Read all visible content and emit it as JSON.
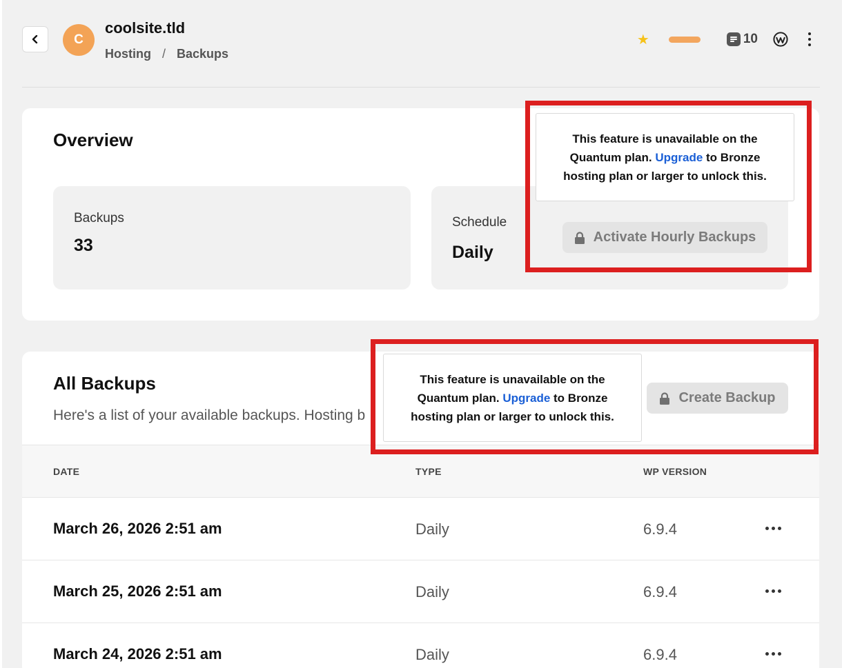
{
  "header": {
    "avatar_letter": "C",
    "site_name": "coolsite.tld",
    "breadcrumb": [
      "Hosting",
      "/",
      "Backups"
    ],
    "count": "10",
    "icons": [
      "back-chevron-icon",
      "star-icon",
      "document-icon",
      "wordpress-icon",
      "kebab-menu-icon"
    ]
  },
  "overview": {
    "title": "Overview",
    "backups_label": "Backups",
    "backups_value": "33",
    "schedule_label": "Schedule",
    "schedule_value": "Daily",
    "tooltip": {
      "before": "This feature is unavailable on the Quantum plan. ",
      "link": "Upgrade",
      "after": " to Bronze hosting plan or larger to unlock this."
    },
    "activate_button": "Activate Hourly Backups"
  },
  "all_backups": {
    "title": "All Backups",
    "subtitle": "Here's a list of your available backups. Hosting b",
    "tooltip": {
      "before": "This feature is unavailable on the Quantum plan. ",
      "link": "Upgrade",
      "after": " to Bronze hosting plan or larger to unlock this."
    },
    "create_button": "Create Backup",
    "columns": [
      "DATE",
      "TYPE",
      "WP VERSION"
    ],
    "rows": [
      {
        "date": "March 26, 2026 2:51 am",
        "type": "Daily",
        "version": "6.9.4"
      },
      {
        "date": "March 25, 2026 2:51 am",
        "type": "Daily",
        "version": "6.9.4"
      },
      {
        "date": "March 24, 2026 2:51 am",
        "type": "Daily",
        "version": "6.9.4"
      }
    ]
  },
  "colors": {
    "accent_orange": "#f3a356",
    "star": "#f6c21a",
    "link_blue": "#1a5fd6",
    "highlight_red": "#dc1f1f"
  }
}
